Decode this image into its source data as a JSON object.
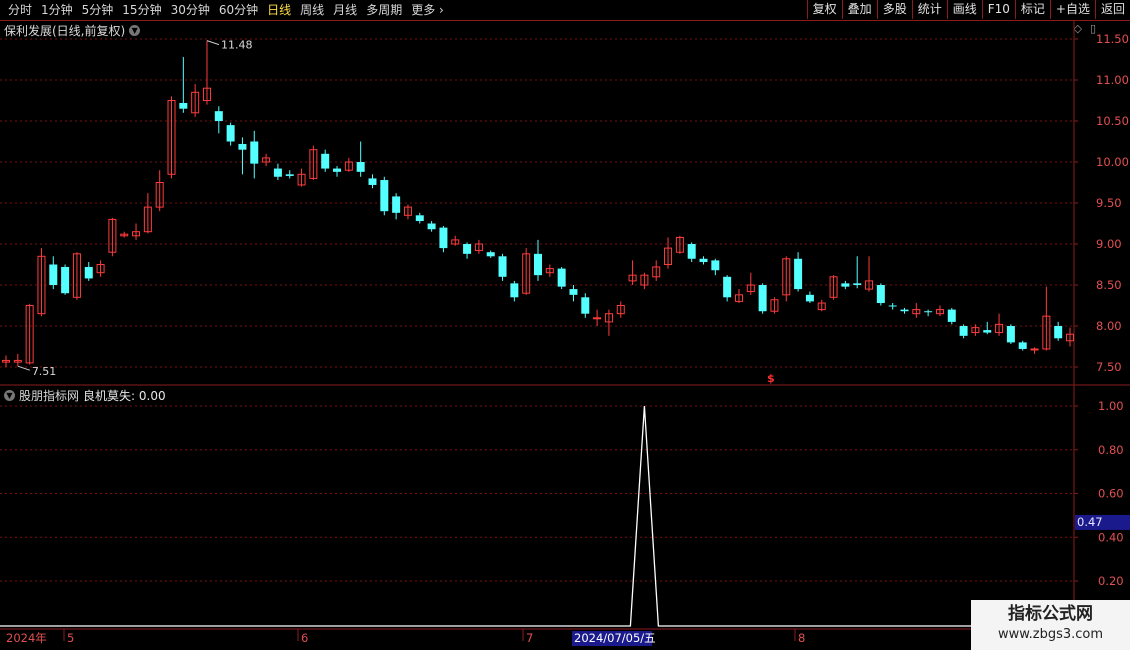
{
  "toolbar": {
    "periods": [
      "分时",
      "1分钟",
      "5分钟",
      "15分钟",
      "30分钟",
      "60分钟",
      "日线",
      "周线",
      "月线",
      "多周期",
      "更多"
    ],
    "active_period": "日线",
    "buttons": [
      "复权",
      "叠加",
      "多股",
      "统计",
      "画线",
      "F10",
      "标记",
      "+自选",
      "返回"
    ]
  },
  "stock_title": "保利发展(日线,前复权)",
  "price_axis": {
    "labels": [
      "11.50",
      "11.00",
      "10.50",
      "10.00",
      "9.50",
      "9.00",
      "8.50",
      "8.00",
      "7.50"
    ]
  },
  "annotations": {
    "high": "11.48",
    "low": "7.51",
    "marker": "$"
  },
  "indicator": {
    "name": "股朋指标网",
    "label": "良机莫失: 0.00",
    "axis_labels": [
      "1.00",
      "0.80",
      "0.60",
      "0.40",
      "0.20"
    ],
    "current_value": "0.47"
  },
  "date_axis": {
    "year": "2024年",
    "months": [
      "5",
      "6",
      "7",
      "8"
    ],
    "cursor_date": "2024/07/05/五"
  },
  "watermark": {
    "line1": "指标公式网",
    "line2": "www.zbgs3.com"
  },
  "colors": {
    "up": "#ff3c3c",
    "down": "#54ffff",
    "grid": "#7a1010",
    "axis": "#8b1b1b",
    "signal": "#ffffff"
  },
  "chart_data": {
    "type": "candlestick",
    "ylim": [
      7.35,
      11.6
    ],
    "candles": [
      [
        7.56,
        7.58,
        7.5,
        7.64
      ],
      [
        7.56,
        7.58,
        7.51,
        7.66
      ],
      [
        7.55,
        8.25,
        7.53,
        8.27
      ],
      [
        8.15,
        8.85,
        8.12,
        8.95
      ],
      [
        8.75,
        8.5,
        8.45,
        8.85
      ],
      [
        8.72,
        8.4,
        8.38,
        8.75
      ],
      [
        8.35,
        8.88,
        8.32,
        8.9
      ],
      [
        8.72,
        8.58,
        8.55,
        8.78
      ],
      [
        8.65,
        8.75,
        8.6,
        8.8
      ],
      [
        8.9,
        9.3,
        8.85,
        9.32
      ],
      [
        9.1,
        9.12,
        9.08,
        9.15
      ],
      [
        9.1,
        9.15,
        9.05,
        9.25
      ],
      [
        9.15,
        9.45,
        9.13,
        9.62
      ],
      [
        9.45,
        9.75,
        9.4,
        9.9
      ],
      [
        9.85,
        10.75,
        9.8,
        10.8
      ],
      [
        10.72,
        10.65,
        10.6,
        11.28
      ],
      [
        10.6,
        10.85,
        10.55,
        10.95
      ],
      [
        10.75,
        10.9,
        10.7,
        11.48
      ],
      [
        10.62,
        10.5,
        10.35,
        10.68
      ],
      [
        10.45,
        10.25,
        10.2,
        10.48
      ],
      [
        10.22,
        10.15,
        9.85,
        10.3
      ],
      [
        10.25,
        9.98,
        9.8,
        10.38
      ],
      [
        10.0,
        10.05,
        9.95,
        10.1
      ],
      [
        9.92,
        9.82,
        9.78,
        9.98
      ],
      [
        9.85,
        9.83,
        9.8,
        9.9
      ],
      [
        9.72,
        9.85,
        9.7,
        9.92
      ],
      [
        9.8,
        10.15,
        9.78,
        10.2
      ],
      [
        10.1,
        9.92,
        9.88,
        10.15
      ],
      [
        9.92,
        9.88,
        9.82,
        9.95
      ],
      [
        9.9,
        10.0,
        9.88,
        10.05
      ],
      [
        10.0,
        9.88,
        9.82,
        10.25
      ],
      [
        9.8,
        9.72,
        9.68,
        9.85
      ],
      [
        9.78,
        9.4,
        9.35,
        9.82
      ],
      [
        9.58,
        9.38,
        9.3,
        9.62
      ],
      [
        9.35,
        9.45,
        9.3,
        9.48
      ],
      [
        9.35,
        9.28,
        9.25,
        9.38
      ],
      [
        9.25,
        9.18,
        9.15,
        9.28
      ],
      [
        9.2,
        8.95,
        8.9,
        9.22
      ],
      [
        9.0,
        9.05,
        8.98,
        9.1
      ],
      [
        9.0,
        8.88,
        8.82,
        9.02
      ],
      [
        8.92,
        9.0,
        8.88,
        9.05
      ],
      [
        8.9,
        8.85,
        8.83,
        8.92
      ],
      [
        8.85,
        8.6,
        8.55,
        8.88
      ],
      [
        8.52,
        8.35,
        8.3,
        8.55
      ],
      [
        8.4,
        8.88,
        8.38,
        8.95
      ],
      [
        8.88,
        8.62,
        8.55,
        9.05
      ],
      [
        8.65,
        8.7,
        8.6,
        8.75
      ],
      [
        8.7,
        8.48,
        8.45,
        8.72
      ],
      [
        8.45,
        8.38,
        8.3,
        8.5
      ],
      [
        8.35,
        8.15,
        8.1,
        8.4
      ],
      [
        8.1,
        8.1,
        8.0,
        8.2
      ],
      [
        8.05,
        8.15,
        7.88,
        8.2
      ],
      [
        8.15,
        8.25,
        8.1,
        8.3
      ],
      [
        8.55,
        8.62,
        8.5,
        8.8
      ],
      [
        8.5,
        8.62,
        8.45,
        8.65
      ],
      [
        8.6,
        8.72,
        8.55,
        8.8
      ],
      [
        8.75,
        8.95,
        8.7,
        9.08
      ],
      [
        8.9,
        9.08,
        8.88,
        9.1
      ],
      [
        9.0,
        8.82,
        8.78,
        9.02
      ],
      [
        8.82,
        8.78,
        8.75,
        8.85
      ],
      [
        8.8,
        8.68,
        8.62,
        8.82
      ],
      [
        8.6,
        8.35,
        8.3,
        8.62
      ],
      [
        8.3,
        8.38,
        8.28,
        8.45
      ],
      [
        8.42,
        8.5,
        8.38,
        8.65
      ],
      [
        8.5,
        8.18,
        8.15,
        8.52
      ],
      [
        8.18,
        8.32,
        8.15,
        8.35
      ],
      [
        8.38,
        8.82,
        8.3,
        8.85
      ],
      [
        8.82,
        8.45,
        8.42,
        8.9
      ],
      [
        8.38,
        8.3,
        8.28,
        8.42
      ],
      [
        8.2,
        8.28,
        8.18,
        8.32
      ],
      [
        8.35,
        8.6,
        8.32,
        8.62
      ],
      [
        8.52,
        8.48,
        8.45,
        8.55
      ],
      [
        8.52,
        8.5,
        8.46,
        8.85
      ],
      [
        8.45,
        8.55,
        8.42,
        8.85
      ],
      [
        8.5,
        8.28,
        8.25,
        8.52
      ],
      [
        8.25,
        8.24,
        8.2,
        8.28
      ],
      [
        8.2,
        8.18,
        8.15,
        8.22
      ],
      [
        8.15,
        8.2,
        8.1,
        8.28
      ],
      [
        8.18,
        8.17,
        8.12,
        8.2
      ],
      [
        8.15,
        8.2,
        8.12,
        8.25
      ],
      [
        8.2,
        8.05,
        8.02,
        8.22
      ],
      [
        8.0,
        7.88,
        7.85,
        8.02
      ],
      [
        7.92,
        7.98,
        7.88,
        8.02
      ],
      [
        7.95,
        7.92,
        7.9,
        8.05
      ],
      [
        7.92,
        8.02,
        7.88,
        8.15
      ],
      [
        8.0,
        7.8,
        7.78,
        8.02
      ],
      [
        7.8,
        7.72,
        7.7,
        7.82
      ],
      [
        7.72,
        7.72,
        7.66,
        7.74
      ],
      [
        7.72,
        8.12,
        7.7,
        8.48
      ],
      [
        8.0,
        7.85,
        7.82,
        8.05
      ],
      [
        7.82,
        7.9,
        7.75,
        7.98
      ]
    ],
    "indicator_values_note": "signal line 0 everywhere except single spike to 1.00 near 2024-07",
    "indicator_spike_index": 54,
    "indicator_ylim": [
      0,
      1.1
    ]
  }
}
